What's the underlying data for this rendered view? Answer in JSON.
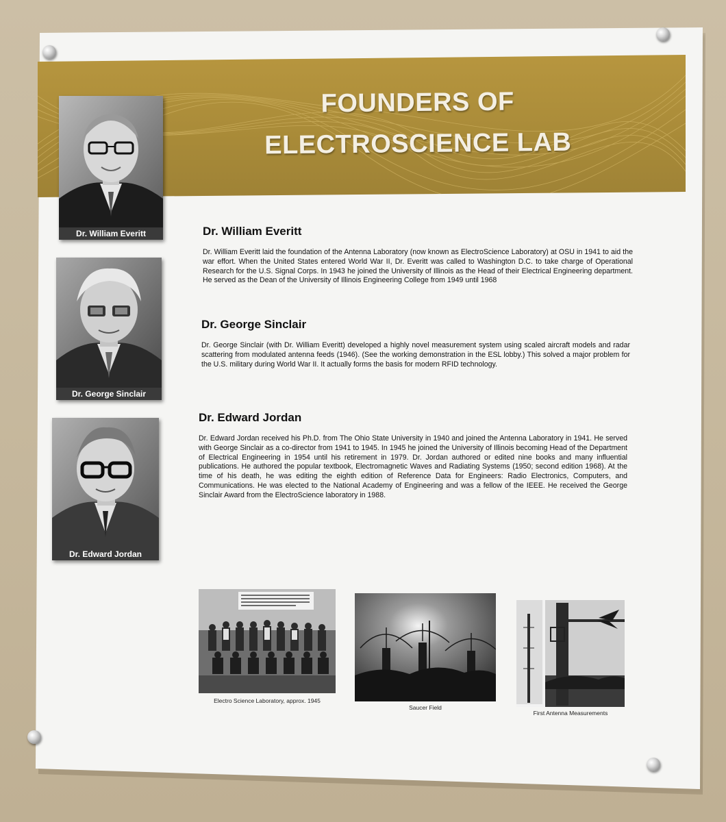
{
  "banner": {
    "title_line1": "FOUNDERS OF",
    "title_line2": "ELECTROSCIENCE LAB"
  },
  "portraits": [
    {
      "caption": "Dr. William Everitt"
    },
    {
      "caption": "Dr. George Sinclair"
    },
    {
      "caption": "Dr. Edward Jordan"
    }
  ],
  "bios": [
    {
      "name": "Dr. William Everitt",
      "text": "Dr. William Everitt laid the foundation of the Antenna Laboratory (now known as ElectroScience Laboratory) at OSU in 1941 to aid the war effort. When the United States entered World War II, Dr. Everitt was called to Washington D.C. to take charge of Operational Research for the U.S. Signal Corps. In 1943 he joined the University of Illinois as the Head of their Electrical Engineering department. He served as the Dean of the University of Illinois Engineering College from 1949 until 1968"
    },
    {
      "name": "Dr. George Sinclair",
      "text": "Dr. George Sinclair (with Dr. William Everitt) developed a highly novel measurement system using scaled aircraft models and radar scattering from modulated antenna feeds (1946).  (See the working demonstration in the ESL lobby.) This solved a major problem for the U.S. military during World War II. It actually forms the basis for modern RFID technology."
    },
    {
      "name": "Dr. Edward Jordan",
      "text": "Dr. Edward Jordan received his Ph.D. from The Ohio State University in 1940 and joined the Antenna Laboratory in 1941. He served with George Sinclair as a co-director from 1941 to 1945. In 1945 he joined the University of Illinois becoming Head of the Department of Electrical Engineering in 1954 until his retirement in 1979. Dr. Jordan authored or edited nine books and many influential publications. He authored the popular textbook, Electromagnetic Waves and Radiating Systems (1950; second edition 1968). At the time of his death, he was editing the eighth edition of Reference Data for Engineers: Radio Electronics, Computers, and Communications. He was elected to the National Academy of Engineering and was a fellow of the IEEE. He received the George Sinclair Award from the ElectroScience laboratory in 1988."
    }
  ],
  "photos": [
    {
      "caption": "Electro Science Laboratory, approx. 1945"
    },
    {
      "caption": "Saucer Field"
    },
    {
      "caption": "First Antenna Measurements"
    }
  ]
}
